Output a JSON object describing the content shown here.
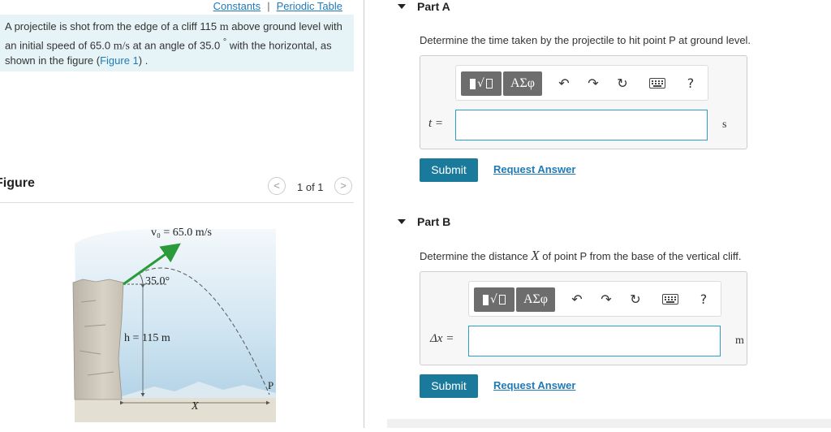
{
  "header": {
    "constants_link": "Constants",
    "separator": "|",
    "periodic_link": "Periodic Table"
  },
  "problem": {
    "text1": "A projectile is shot from the edge of a cliff 115 ",
    "unit_m": "m",
    "text2": " above ground level with an initial speed of 65.0 ",
    "unit_ms": "m/s",
    "text3": " at an angle of 35.0 ",
    "degree": "°",
    "text4": " with the horizontal, as shown in the figure (",
    "figure_link": "Figure 1",
    "text5": ") ."
  },
  "figure": {
    "title": "Figure",
    "prev": "<",
    "next": ">",
    "pager": "1 of 1",
    "v0_label": "v₀ = 65.0 m/s",
    "angle_label": "35.0°",
    "h_label": "h = 115 m",
    "x_label": "X",
    "p_label": "P"
  },
  "part_a": {
    "title": "Part A",
    "question": "Determine the time taken by the projectile to hit point P at ground level.",
    "answer_label": "t =",
    "answer_value": "",
    "unit": "s",
    "greek": "ΑΣφ",
    "help": "?",
    "submit": "Submit",
    "request": "Request Answer"
  },
  "part_b": {
    "title": "Part B",
    "question_pre": "Determine the distance ",
    "question_var": "X",
    "question_post": " of point P from the base of the vertical cliff.",
    "answer_label": "Δx =",
    "answer_value": "",
    "unit": "m",
    "greek": "ΑΣφ",
    "help": "?",
    "submit": "Submit",
    "request": "Request Answer"
  },
  "toolbar_icons": [
    "template-icon",
    "greek-symbols-icon",
    "undo-icon",
    "redo-icon",
    "reset-icon",
    "keyboard-icon",
    "help-icon"
  ],
  "colors": {
    "accent": "#1a7a9c",
    "link": "#1f7ab8",
    "problem_bg": "#e6f4f8",
    "input_border": "#2b9fc7"
  }
}
